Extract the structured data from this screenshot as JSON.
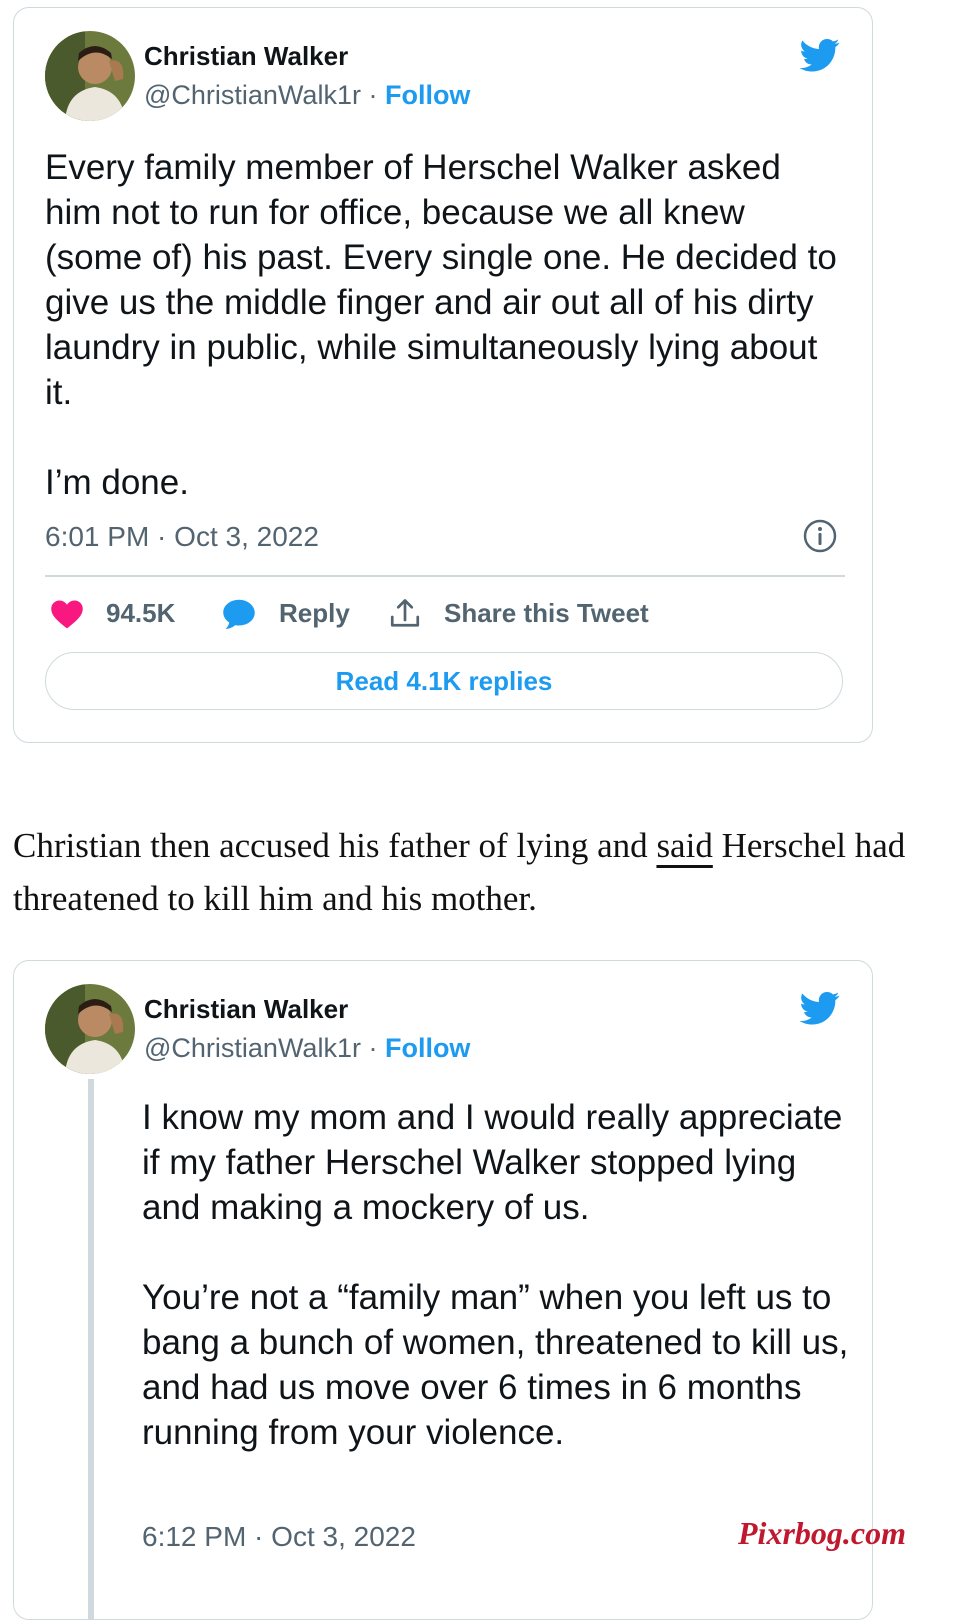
{
  "tweet1": {
    "author_name": "Christian Walker",
    "handle": "@ChristianWalk1r",
    "separator": " · ",
    "follow_label": "Follow",
    "text": "Every family member of Herschel Walker asked him not to run for office, because we all knew (some of) his past. Every single one. He decided to give us the middle finger and air out all of his dirty laundry in public, while simultaneously lying about it.\n\nI’m done.",
    "timestamp": "6:01 PM · Oct 3, 2022",
    "like_count": "94.5K",
    "reply_label": "Reply",
    "share_label": "Share this Tweet",
    "read_replies_label": "Read 4.1K replies"
  },
  "article": {
    "line1_before": "Christian then accused his father of lying and ",
    "link_text": "said",
    "line1_after": " Herschel had",
    "line2": "threatened to kill him and his mother."
  },
  "tweet2": {
    "author_name": "Christian Walker",
    "handle": "@ChristianWalk1r",
    "separator": " · ",
    "follow_label": "Follow",
    "text": "I know my mom and I would really appreciate if my father Herschel Walker stopped lying and making a mockery of us.\n\nYou’re not a “family man” when you left us to bang a bunch of women, threatened to kill us, and had us move over 6 times in 6 months running from your violence.",
    "timestamp": "6:12 PM · Oct 3, 2022"
  },
  "watermark": "Pixrbog.com",
  "colors": {
    "brand_blue": "#1d9bf0",
    "like_red": "#f91880",
    "muted_text": "#536471",
    "border": "#cfd9de"
  },
  "icons": [
    "twitter-bird-icon",
    "info-icon",
    "heart-icon",
    "speech-bubble-icon",
    "share-upload-icon"
  ]
}
